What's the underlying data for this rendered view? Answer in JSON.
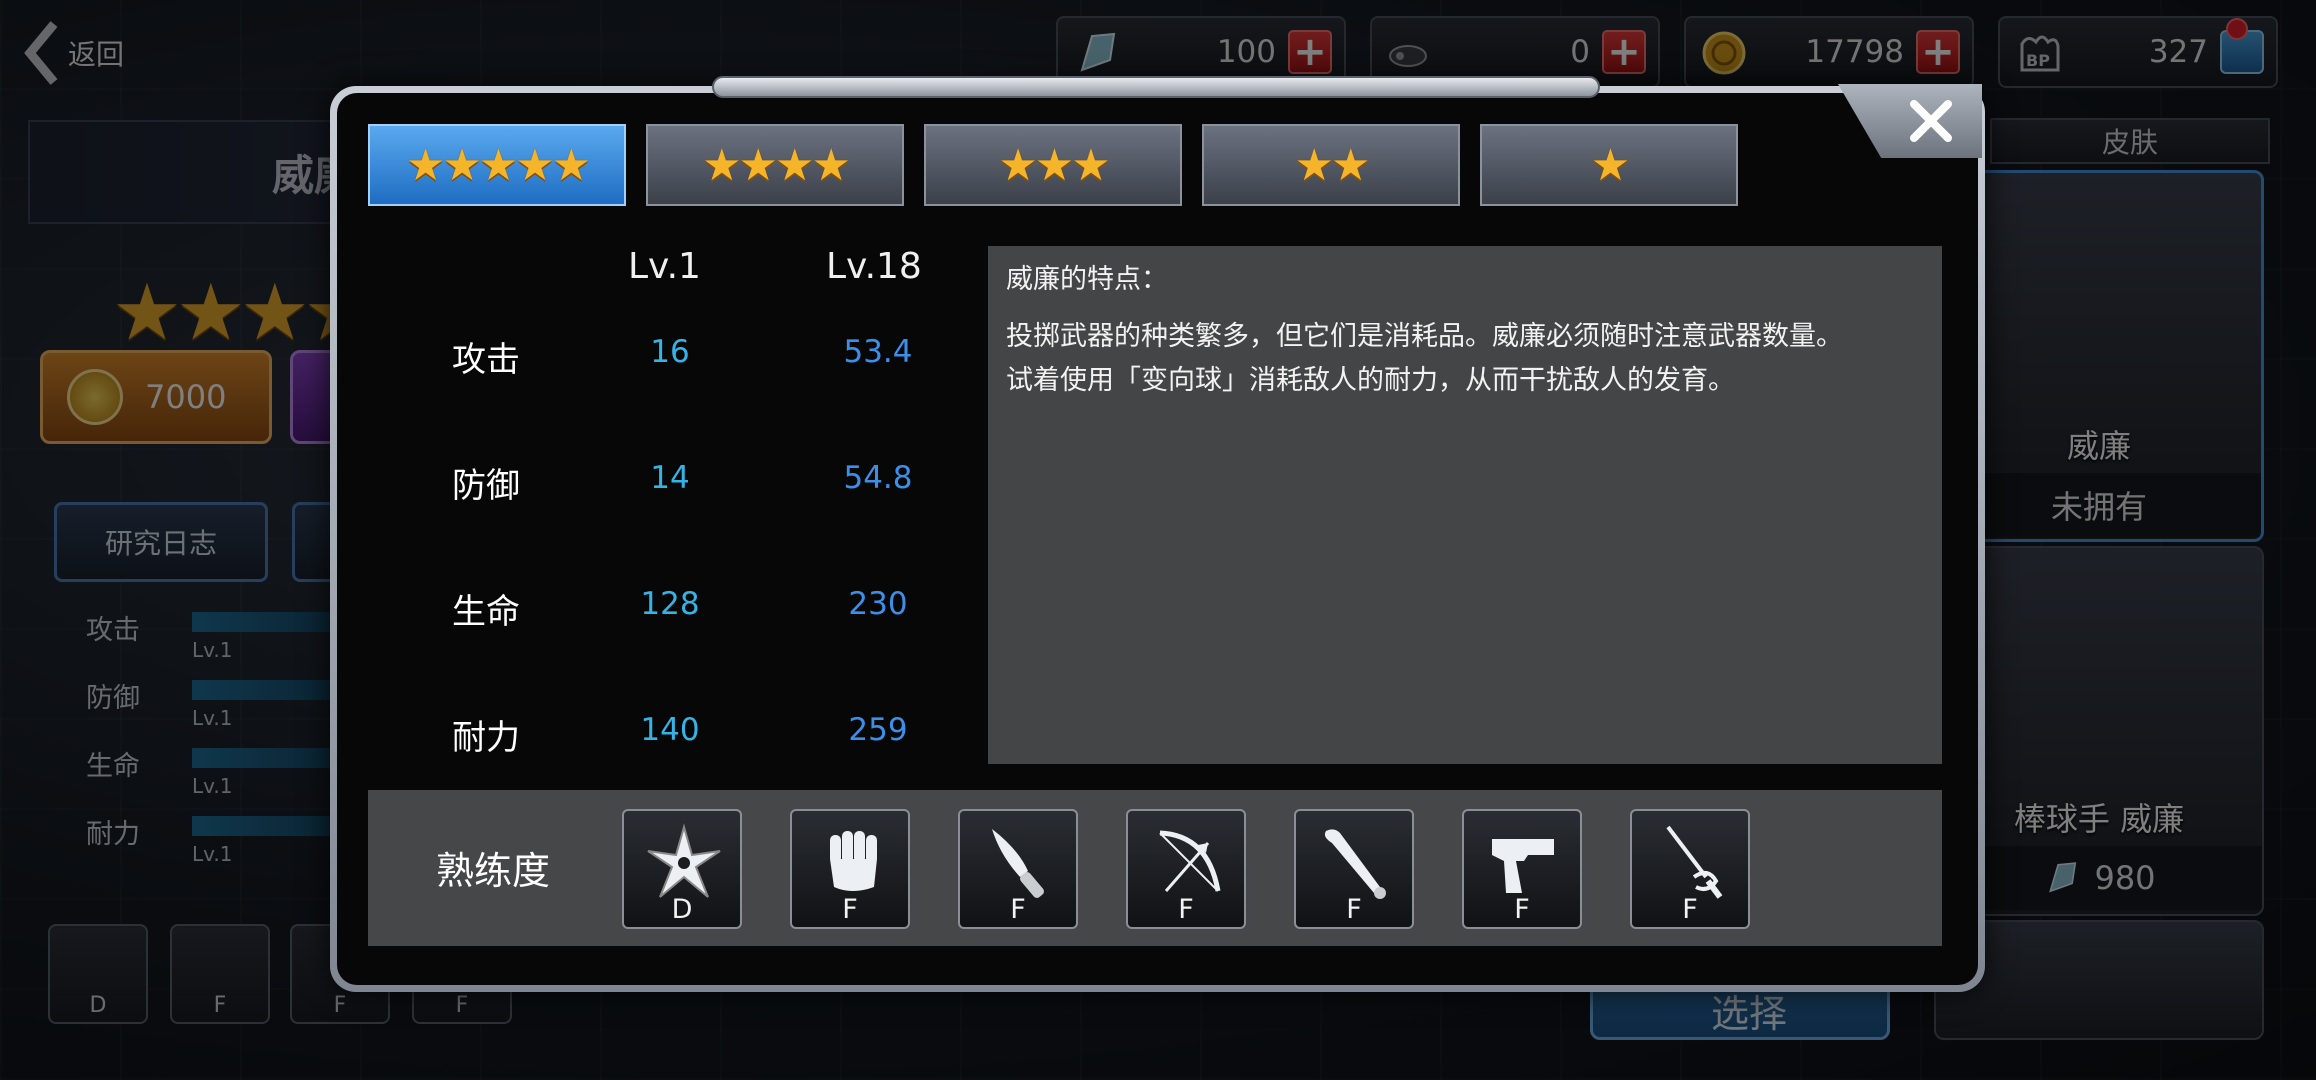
{
  "nav": {
    "back_label": "返回"
  },
  "currencies": [
    {
      "icon": "diamond-icon",
      "value": "100"
    },
    {
      "icon": "ticket-icon",
      "value": "0"
    },
    {
      "icon": "gold-coin-icon",
      "value": "17798"
    },
    {
      "icon": "bp-icon",
      "value": "327"
    }
  ],
  "character": {
    "name": "威廉",
    "unlock_cost": "7000",
    "research_log_label": "研究日志",
    "stats": [
      {
        "label": "攻击",
        "level": "Lv.1"
      },
      {
        "label": "防御",
        "level": "Lv.1"
      },
      {
        "label": "生命",
        "level": "Lv.1"
      },
      {
        "label": "耐力",
        "level": "Lv.1"
      }
    ],
    "proficiency_grades": [
      "D",
      "F",
      "F",
      "F"
    ]
  },
  "skins": {
    "header": "皮肤",
    "items": [
      {
        "name": "威廉",
        "status": "未拥有"
      },
      {
        "name": "棒球手 威廉",
        "price": "980"
      }
    ],
    "select_label": "选择"
  },
  "modal": {
    "tabs": [
      {
        "stars": "★★★★★",
        "active": true
      },
      {
        "stars": "★★★★",
        "active": false
      },
      {
        "stars": "★★★",
        "active": false
      },
      {
        "stars": "★★",
        "active": false
      },
      {
        "stars": "★",
        "active": false
      }
    ],
    "col_lv1": "Lv.1",
    "col_lv18": "Lv.18",
    "stats": [
      {
        "label": "攻击",
        "lv1": "16",
        "lv18": "53.4"
      },
      {
        "label": "防御",
        "lv1": "14",
        "lv18": "54.8"
      },
      {
        "label": "生命",
        "lv1": "128",
        "lv18": "230"
      },
      {
        "label": "耐力",
        "lv1": "140",
        "lv18": "259"
      }
    ],
    "description": {
      "title": "威廉的特点：",
      "line1": "投掷武器的种类繁多，但它们是消耗品。威廉必须随时注意武器数量。",
      "line2": "试着使用「变向球」消耗敌人的耐力，从而干扰敌人的发育。"
    },
    "proficiency": {
      "label": "熟练度",
      "weapons": [
        {
          "icon": "shuriken-icon",
          "grade": "D"
        },
        {
          "icon": "fist-icon",
          "grade": "F"
        },
        {
          "icon": "knife-icon",
          "grade": "F"
        },
        {
          "icon": "bow-icon",
          "grade": "F"
        },
        {
          "icon": "bat-icon",
          "grade": "F"
        },
        {
          "icon": "pistol-icon",
          "grade": "F"
        },
        {
          "icon": "rapier-icon",
          "grade": "F"
        }
      ]
    }
  },
  "colors": {
    "tab_active": "#2f86dc",
    "star": "#f5b52a",
    "lv1_value": "#34b4e6",
    "lv18_value": "#3c8fe8",
    "plus_button": "#d42828"
  }
}
